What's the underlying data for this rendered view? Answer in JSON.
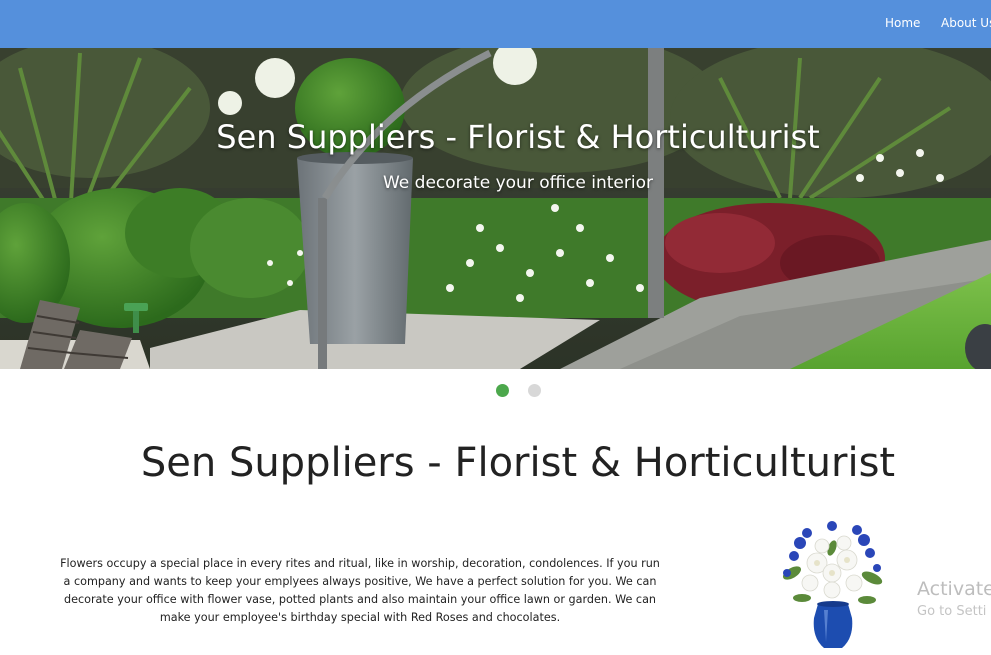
{
  "navbar": {
    "links": [
      {
        "label": "Home"
      },
      {
        "label": "About Us"
      }
    ],
    "background_color": "#5590dc"
  },
  "hero": {
    "title": "Sen Suppliers - Florist & Horticulturist",
    "subtitle": "We decorate your office interior",
    "slides_count": 2,
    "active_slide": 1,
    "active_dot_color": "#4ca84c",
    "inactive_dot_color": "#d8d8d8"
  },
  "main": {
    "title": "Sen Suppliers - Florist & Horticulturist",
    "intro": "Flowers occupy a special place in every rites and ritual, like in worship, decoration, condolences. If you run a company and wants to keep your emplyees always positive, We have a perfect solution for you. We can decorate your office with flower vase, potted plants and also maintain your office lawn or garden. We can make your employee's birthday special with Red Roses and chocolates."
  },
  "watermark": {
    "title": "Activate",
    "subtitle": "Go to Setti"
  }
}
